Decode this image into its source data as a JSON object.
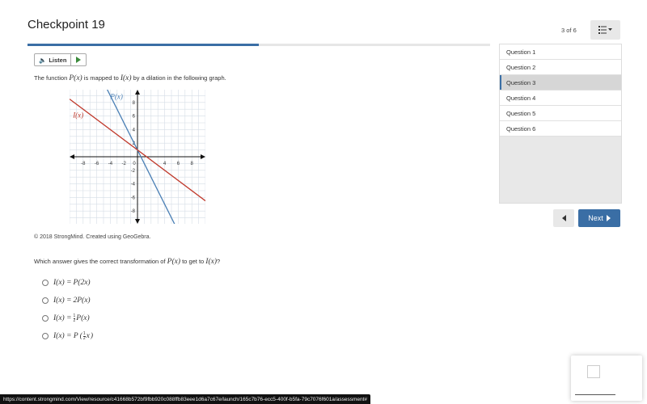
{
  "header": {
    "title": "Checkpoint 19",
    "progress_fraction": 0.5
  },
  "listen": {
    "label": "Listen",
    "speaker_icon": "speaker-icon",
    "play_icon": "play-icon"
  },
  "prompt": {
    "before": "The function ",
    "p": "P(x)",
    "middle": " is mapped to ",
    "i": "I(x)",
    "after": " by a dilation in the following graph."
  },
  "graph": {
    "x_ticks": [
      "-8",
      "-6",
      "-4",
      "-2",
      "0",
      "4",
      "6",
      "8"
    ],
    "y_ticks": [
      "8",
      "6",
      "4",
      "2",
      "-2",
      "-4",
      "-6",
      "-8"
    ],
    "lines": [
      {
        "label": "P(x)",
        "color": "#4a7fb5",
        "slope": -2,
        "intercept": 1
      },
      {
        "label": "I(x)",
        "color": "#c0392b",
        "slope": -0.75,
        "intercept": 1
      }
    ],
    "range": [
      -10,
      10
    ]
  },
  "credit": "© 2018 StrongMind. Created using GeoGebra.",
  "question": {
    "before": "Which answer gives the correct transformation of ",
    "p": "P(x)",
    "middle": " to get to ",
    "i": "I(x)",
    "after": "?"
  },
  "options": [
    {
      "lhs": "I(x) = ",
      "rhs": "P(2x)"
    },
    {
      "lhs": "I(x) = ",
      "rhs": "2P(x)"
    },
    {
      "lhs": "I(x) = ",
      "num": "1",
      "den": "2",
      "rhs": "P(x)"
    },
    {
      "lhs": "I(x) = P",
      "num": "1",
      "den": "2",
      "rhs": "x"
    }
  ],
  "nav": {
    "counter": "3 of 6",
    "menu_icon": "list-menu-icon",
    "questions": [
      "Question 1",
      "Question 2",
      "Question 3",
      "Question 4",
      "Question 5",
      "Question 6"
    ],
    "active_index": 2,
    "next_label": "Next"
  },
  "status_url": "https://content.strongmind.com/View/resource/c41668b572bf9fbb920c088ffb83eee1d6a7c67e/launch/165c7b76-ecc5-400f-b5fa-79c7076f601a/assessment#"
}
